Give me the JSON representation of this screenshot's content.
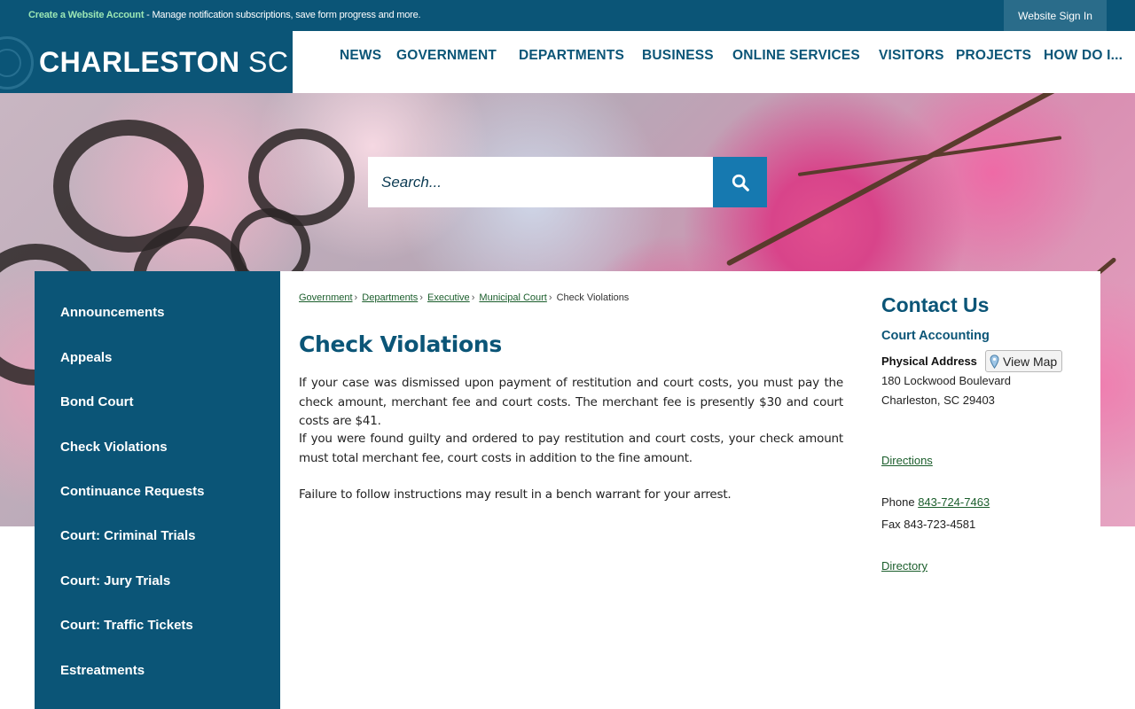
{
  "topbar": {
    "create_account": "Create a Website Account",
    "message": " - Manage notification subscriptions, save form progress and more.",
    "signin": "Website Sign In"
  },
  "brand": {
    "name": "CHARLESTON",
    "suffix": "SC"
  },
  "nav": [
    "NEWS",
    "GOVERNMENT",
    "DEPARTMENTS",
    "BUSINESS",
    "ONLINE SERVICES",
    "VISITORS",
    "PROJECTS",
    "HOW DO I..."
  ],
  "search": {
    "placeholder": "Search..."
  },
  "sidebar": {
    "items": [
      "Announcements",
      "Appeals",
      "Bond Court",
      "Check Violations",
      "Continuance Requests",
      "Court: Criminal Trials",
      "Court: Jury Trials",
      "Court: Traffic Tickets",
      "Estreatments"
    ]
  },
  "breadcrumb": {
    "links": [
      "Government",
      "Departments",
      "Executive",
      "Municipal Court"
    ],
    "current": "Check Violations"
  },
  "page": {
    "title": "Check Violations",
    "paragraphs": [
      "If your case was dismissed upon payment of restitution and court costs, you must pay the check amount, merchant fee and court costs. The merchant fee is presently $30 and court costs are $41.",
      "If you were found guilty and ordered to pay restitution and court costs, your check amount must total merchant fee, court costs in addition to the fine amount.",
      "Failure to follow instructions may result in a bench warrant for your arrest."
    ]
  },
  "contact": {
    "heading": "Contact Us",
    "department": "Court Accounting",
    "address_label": "Physical Address",
    "view_map": "View Map",
    "address_line1": "180 Lockwood Boulevard",
    "address_line2": "Charleston, SC 29403",
    "directions": "Directions",
    "phone_label": "Phone ",
    "phone": "843-724-7463",
    "fax": "Fax 843-723-4581",
    "directory": "Directory"
  },
  "colors": {
    "brand": "#0b5577",
    "search_button": "#1679b0",
    "link_green": "#1b5e2c",
    "account_green": "#9be6b4"
  }
}
